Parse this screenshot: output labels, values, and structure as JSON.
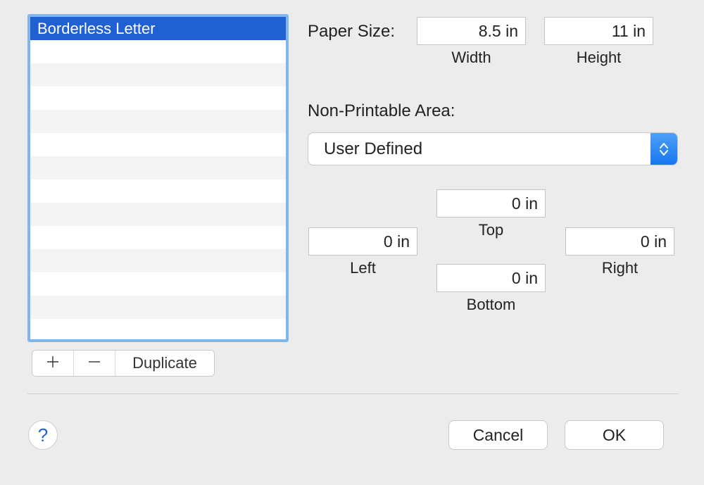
{
  "list": {
    "items": [
      "Borderless Letter"
    ],
    "selected_index": 0
  },
  "toolbar": {
    "add_glyph": "＋",
    "remove_glyph": "－",
    "duplicate_label": "Duplicate"
  },
  "paper_size": {
    "label": "Paper Size:",
    "width_value": "8.5 in",
    "height_value": "11 in",
    "width_label": "Width",
    "height_label": "Height"
  },
  "non_printable": {
    "label": "Non-Printable Area:",
    "select_value": "User Defined",
    "top": {
      "value": "0 in",
      "label": "Top"
    },
    "left": {
      "value": "0 in",
      "label": "Left"
    },
    "right": {
      "value": "0 in",
      "label": "Right"
    },
    "bottom": {
      "value": "0 in",
      "label": "Bottom"
    }
  },
  "help_glyph": "?",
  "buttons": {
    "cancel": "Cancel",
    "ok": "OK"
  }
}
